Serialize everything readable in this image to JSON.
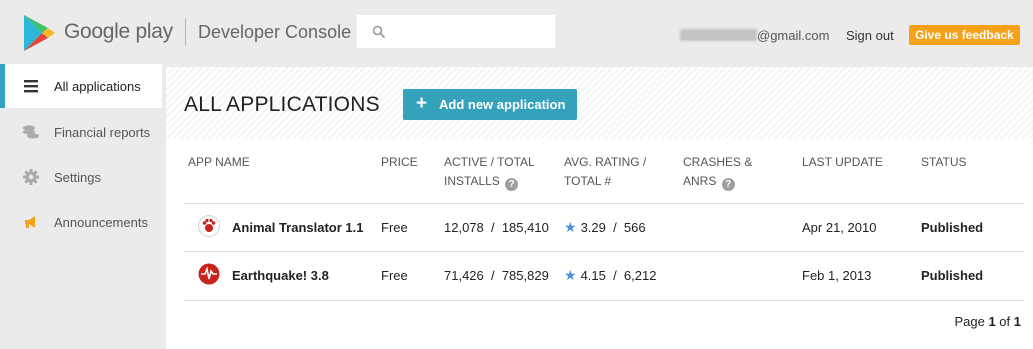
{
  "header": {
    "brand": "Google play",
    "console_title": "Developer Console",
    "search_placeholder": "",
    "email_suffix": "@gmail.com",
    "sign_out": "Sign out",
    "feedback": "Give us feedback"
  },
  "sidebar": {
    "items": [
      {
        "label": "All applications",
        "icon": "menu-icon",
        "active": true
      },
      {
        "label": "Financial reports",
        "icon": "coins-icon",
        "active": false
      },
      {
        "label": "Settings",
        "icon": "gear-icon",
        "active": false
      },
      {
        "label": "Announcements",
        "icon": "megaphone-icon",
        "active": false
      }
    ]
  },
  "main": {
    "title": "ALL APPLICATIONS",
    "add_button": "Add new application",
    "columns": {
      "app_name": "APP NAME",
      "price": "PRICE",
      "installs_1": "ACTIVE / TOTAL",
      "installs_2": "INSTALLS",
      "rating_1": "AVG. RATING /",
      "rating_2": "TOTAL #",
      "crashes_1": "CRASHES &",
      "crashes_2": "ANRS",
      "last_update": "LAST UPDATE",
      "status": "STATUS"
    },
    "rows": [
      {
        "name": "Animal Translator 1.1",
        "price": "Free",
        "installs": "12,078  /  185,410",
        "rating": "3.29  /  566",
        "crashes": "",
        "last_update": "Apr 21, 2010",
        "status": "Published",
        "icon": "paw-icon"
      },
      {
        "name": "Earthquake! 3.8",
        "price": "Free",
        "installs": "71,426  /  785,829",
        "rating": "4.15  /  6,212",
        "crashes": "",
        "last_update": "Feb 1, 2013",
        "status": "Published",
        "icon": "seismograph-icon"
      }
    ],
    "pager": {
      "prefix": "Page",
      "current": "1",
      "of": "of",
      "total": "1"
    }
  },
  "colors": {
    "accent": "#35a2bb",
    "feedback": "#f6a11a",
    "star": "#4a90d9",
    "active_bar": "#33a4bd"
  }
}
